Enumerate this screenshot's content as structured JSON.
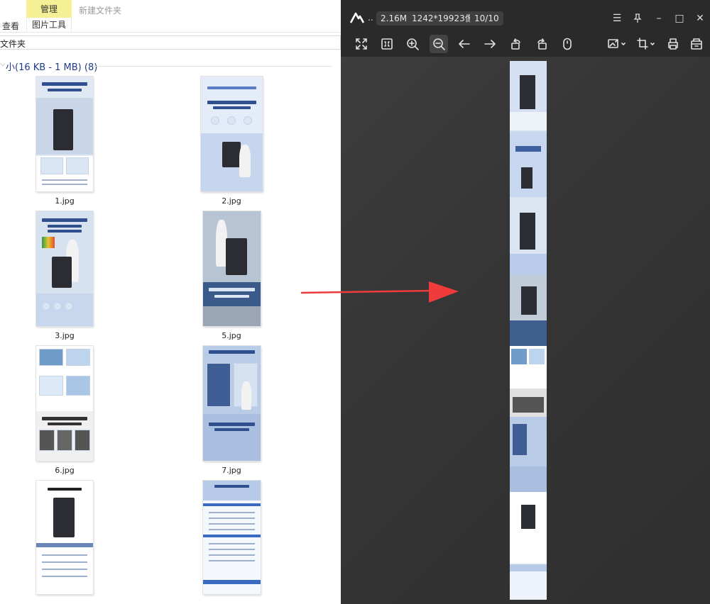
{
  "explorer": {
    "ribbon": {
      "manage_tab": "管理",
      "context_title": "新建文件夹",
      "view_tab": "查看",
      "picture_tools_tab": "图片工具"
    },
    "address": "文件夹",
    "group": {
      "label": "小(16 KB - 1 MB)  (8)"
    },
    "files": [
      {
        "name": "1.jpg"
      },
      {
        "name": "2.jpg"
      },
      {
        "name": "3.jpg"
      },
      {
        "name": "5.jpg"
      },
      {
        "name": "6.jpg"
      },
      {
        "name": "7.jpg"
      }
    ]
  },
  "viewer": {
    "dots": "..",
    "file_size": "2.16M",
    "dimensions": "1242*19923像素",
    "counter": "10/10",
    "icons": [
      "fit-window-icon",
      "actual-size-icon",
      "zoom-in-icon",
      "zoom-out-icon",
      "previous-icon",
      "next-icon",
      "rotate-left-icon",
      "rotate-right-icon",
      "mouse-icon",
      "image-edit-icon",
      "crop-icon",
      "print-icon",
      "more-icon"
    ]
  },
  "colors": {
    "manage_tab_bg": "#f5f096",
    "group_label": "#1e3a8a",
    "viewer_bg": "#353535",
    "arrow": "#ef3b3b"
  }
}
